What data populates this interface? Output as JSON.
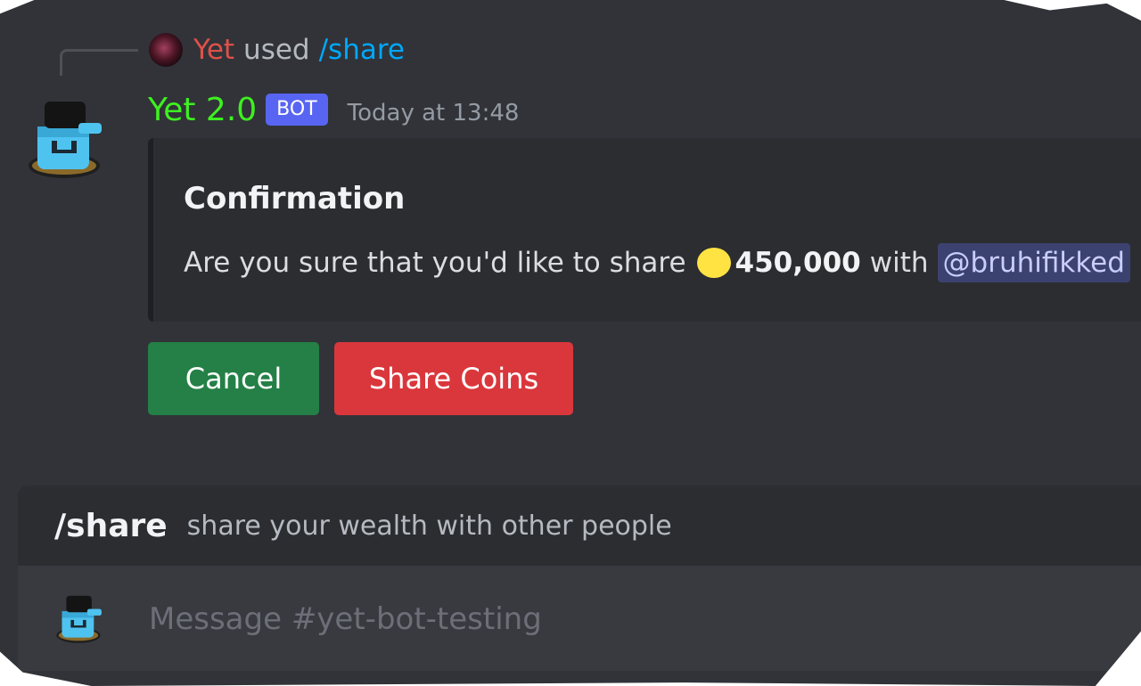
{
  "reply": {
    "user": "Yet",
    "used_text": "used",
    "command": "/share"
  },
  "message": {
    "author": "Yet 2.0",
    "badge": "BOT",
    "timestamp": "Today at 13:48",
    "author_color": "#3ef020"
  },
  "embed": {
    "title": "Confirmation",
    "description_prefix": "Are you sure that you'd like to share",
    "amount": "450,000",
    "description_mid": "with",
    "mention": "@bruhifikked"
  },
  "buttons": {
    "cancel_label": "Cancel",
    "share_label": "Share Coins",
    "cancel_color": "#248046",
    "share_color": "#da373c"
  },
  "command_hint": {
    "name": "/share",
    "description": "share your wealth with other people"
  },
  "composer": {
    "placeholder": "Message #yet-bot-testing"
  },
  "icons": {
    "reply_avatar": "user-avatar-icon",
    "bot_avatar": "bot-avatar-icon",
    "coin": "coin-icon"
  }
}
